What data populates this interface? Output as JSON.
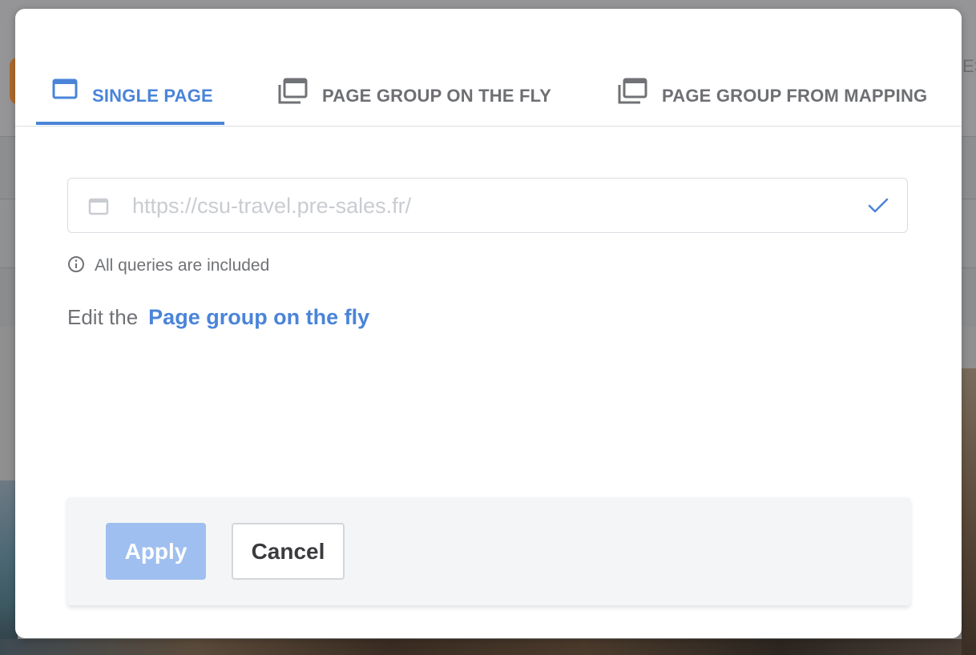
{
  "background": {
    "edge_text": "ES"
  },
  "tabs": [
    {
      "label": "SINGLE PAGE",
      "icon": "single-page-icon",
      "active": true
    },
    {
      "label": "PAGE GROUP ON THE FLY",
      "icon": "page-group-icon",
      "active": false
    },
    {
      "label": "PAGE GROUP FROM MAPPING",
      "icon": "page-group-icon",
      "active": false
    }
  ],
  "url_field": {
    "placeholder": "https://csu-travel.pre-sales.fr/",
    "value": "",
    "leading_icon": "page-icon",
    "trailing_icon": "check-icon"
  },
  "info": {
    "icon": "info-icon",
    "text": "All queries are included"
  },
  "edit": {
    "prefix": "Edit the",
    "link": "Page group on the fly"
  },
  "footer": {
    "apply_label": "Apply",
    "cancel_label": "Cancel"
  },
  "colors": {
    "accent": "#4a84d9",
    "apply_disabled": "#9fbff0",
    "muted_text": "#707276"
  }
}
